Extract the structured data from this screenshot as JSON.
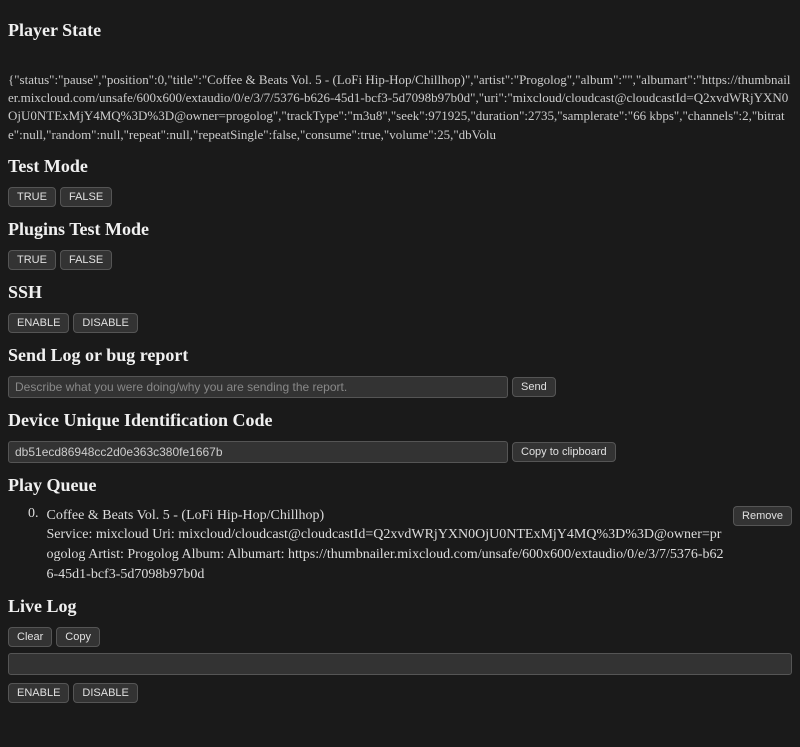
{
  "sections": {
    "playerState": {
      "title": "Player State",
      "content": "{\"status\":\"pause\",\"position\":0,\"title\":\"Coffee & Beats Vol. 5 - (LoFi Hip-Hop/Chillhop)\",\"artist\":\"Progolog\",\"album\":\"\",\"albumart\":\"https://thumbnailer.mixcloud.com/unsafe/600x600/extaudio/0/e/3/7/5376-b626-45d1-bcf3-5d7098b97b0d\",\"uri\":\"mixcloud/cloudcast@cloudcastId=Q2xvdWRjYXN0OjU0NTExMjY4MQ%3D%3D@owner=progolog\",\"trackType\":\"m3u8\",\"seek\":971925,\"duration\":2735,\"samplerate\":\"66 kbps\",\"channels\":2,\"bitrate\":null,\"random\":null,\"repeat\":null,\"repeatSingle\":false,\"consume\":true,\"volume\":25,\"dbVolu"
    },
    "testMode": {
      "title": "Test Mode",
      "trueLabel": "TRUE",
      "falseLabel": "FALSE"
    },
    "pluginsTestMode": {
      "title": "Plugins Test Mode",
      "trueLabel": "TRUE",
      "falseLabel": "FALSE"
    },
    "ssh": {
      "title": "SSH",
      "enableLabel": "ENABLE",
      "disableLabel": "DISABLE"
    },
    "sendLog": {
      "title": "Send Log or bug report",
      "placeholder": "Describe what you were doing/why you are sending the report.",
      "sendLabel": "Send"
    },
    "deviceId": {
      "title": "Device Unique Identification Code",
      "value": "db51ecd86948cc2d0e363c380fe1667b",
      "copyLabel": "Copy to clipboard"
    },
    "playQueue": {
      "title": "Play Queue",
      "items": [
        {
          "index": "0.",
          "title": "Coffee & Beats Vol. 5 - (LoFi Hip-Hop/Chillhop)",
          "details": "Service: mixcloud Uri: mixcloud/cloudcast@cloudcastId=Q2xvdWRjYXN0OjU0NTExMjY4MQ%3D%3D@owner=progolog Artist: Progolog Album: Albumart: https://thumbnailer.mixcloud.com/unsafe/600x600/extaudio/0/e/3/7/5376-b626-45d1-bcf3-5d7098b97b0d",
          "removeLabel": "Remove"
        }
      ]
    },
    "liveLog": {
      "title": "Live Log",
      "clearLabel": "Clear",
      "copyLabel": "Copy",
      "enableLabel": "ENABLE",
      "disableLabel": "DISABLE"
    }
  }
}
